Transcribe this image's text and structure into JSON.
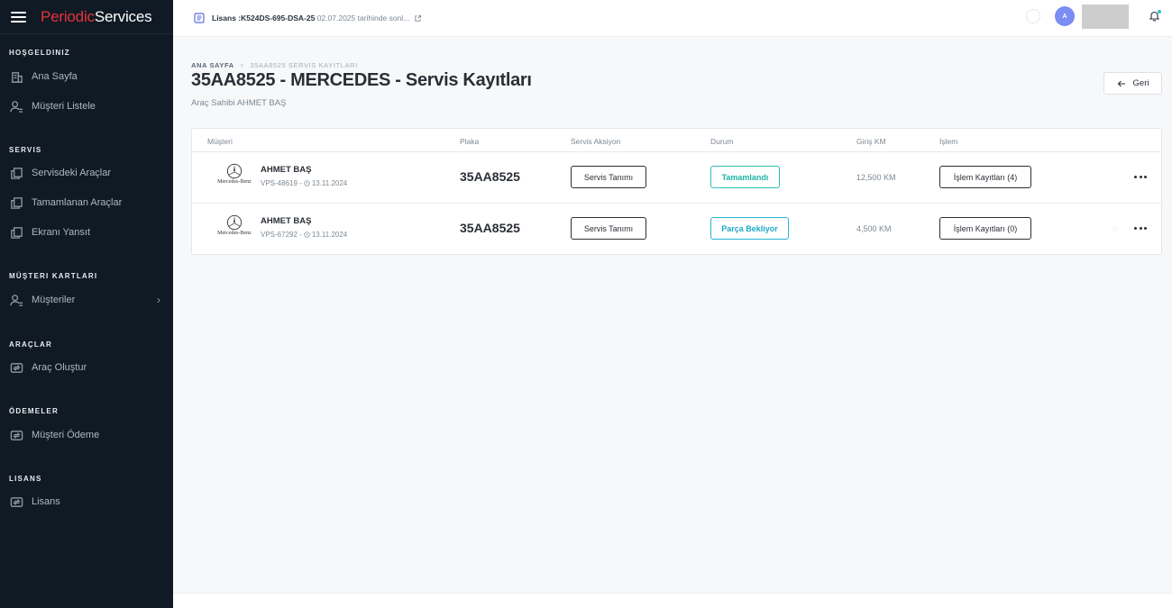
{
  "brand": {
    "part1": "Periodic",
    "part2": "Services",
    "color1": "#e8323c"
  },
  "sidebar": {
    "sections": [
      {
        "title": "HOŞGELDINIZ"
      },
      {
        "title": "SERVIS"
      },
      {
        "title": "MÜŞTERI KARTLARI"
      },
      {
        "title": "ARAÇLAR"
      },
      {
        "title": "ÖDEMELER"
      },
      {
        "title": "LISANS"
      }
    ],
    "items": [
      {
        "label": "Ana Sayfa",
        "icon": "building-icon"
      },
      {
        "label": "Müşteri Listele",
        "icon": "user-list-icon"
      },
      {
        "label": "Servisdeki Araçlar",
        "icon": "copy-icon"
      },
      {
        "label": "Tamamlanan Araçlar",
        "icon": "copy-icon"
      },
      {
        "label": "Ekranı Yansıt",
        "icon": "copy-icon"
      },
      {
        "label": "Müşteriler",
        "icon": "user-list-icon",
        "chevron": "›"
      },
      {
        "label": "Araç Oluştur",
        "icon": "transfer-icon"
      },
      {
        "label": "Müşteri Ödeme",
        "icon": "transfer-icon"
      },
      {
        "label": "Lisans",
        "icon": "transfer-icon"
      }
    ]
  },
  "topbar": {
    "license_label": "Lisans :",
    "license_key": "K524DS-695-DSA-25",
    "license_expiry": "02.07.2025 tarihinde sonl...",
    "avatar_initial": "A",
    "accent": "#7b8cf3"
  },
  "page": {
    "breadcrumb_home": "ANA SAYFA",
    "breadcrumb_current": "35AA8525 SERVIS KAYITLARI",
    "title": "35AA8525 - MERCEDES - Servis Kayıtları",
    "subtitle": "Araç Sahibi AHMET BAŞ",
    "back_label": "Geri"
  },
  "table": {
    "headers": [
      "Müşteri",
      "Plaka",
      "Servis Aksiyon",
      "Durum",
      "Giriş KM",
      "İşlem"
    ],
    "rows": [
      {
        "brand_text": "Mercedes-Benz",
        "customer": "AHMET BAŞ",
        "code": "VPS-48619 -",
        "date": "13.11.2024",
        "plate": "35AA8525",
        "action": "Servis Tanımı",
        "status": "Tamamlandı",
        "status_color": "#1fb5a6",
        "km": "12,500 KM",
        "log": "İşlem Kayıtları (4)"
      },
      {
        "brand_text": "Mercedes-Benz",
        "customer": "AHMET BAŞ",
        "code": "VPS-67292 -",
        "date": "13.11.2024",
        "plate": "35AA8525",
        "action": "Servis Tanımı",
        "status": "Parça Bekliyor",
        "status_color": "#1ea9c6",
        "km": "4,500 KM",
        "log": "İşlem Kayıtları (0)"
      }
    ]
  }
}
